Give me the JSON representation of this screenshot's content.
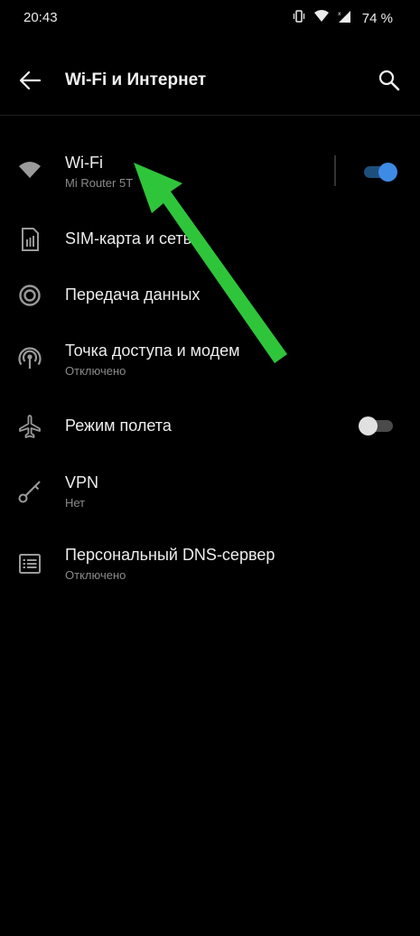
{
  "status_bar": {
    "time": "20:43",
    "battery": "74 %",
    "icons": [
      "vibrate-icon",
      "wifi-icon",
      "signal-icon"
    ]
  },
  "header": {
    "title": "Wi-Fi и Интернет",
    "back_icon": "arrow-left-icon",
    "search_icon": "search-icon"
  },
  "settings": {
    "wifi": {
      "title": "Wi-Fi",
      "subtitle": "Mi Router 5T",
      "icon": "wifi-icon",
      "enabled": true
    },
    "sim": {
      "title": "SIM-карта и сеть",
      "icon": "sim-card-icon"
    },
    "data_usage": {
      "title": "Передача данных",
      "icon": "data-usage-icon"
    },
    "hotspot": {
      "title": "Точка доступа и модем",
      "subtitle": "Отключено",
      "icon": "hotspot-icon"
    },
    "airplane": {
      "title": "Режим полета",
      "icon": "airplane-icon",
      "enabled": false
    },
    "vpn": {
      "title": "VPN",
      "subtitle": "Нет",
      "icon": "vpn-key-icon"
    },
    "dns": {
      "title": "Персональный DNS-сервер",
      "subtitle": "Отключено",
      "icon": "dns-icon"
    }
  },
  "colors": {
    "background": "#000000",
    "accent": "#3d8be4",
    "annotation_arrow": "#2fc53a"
  }
}
